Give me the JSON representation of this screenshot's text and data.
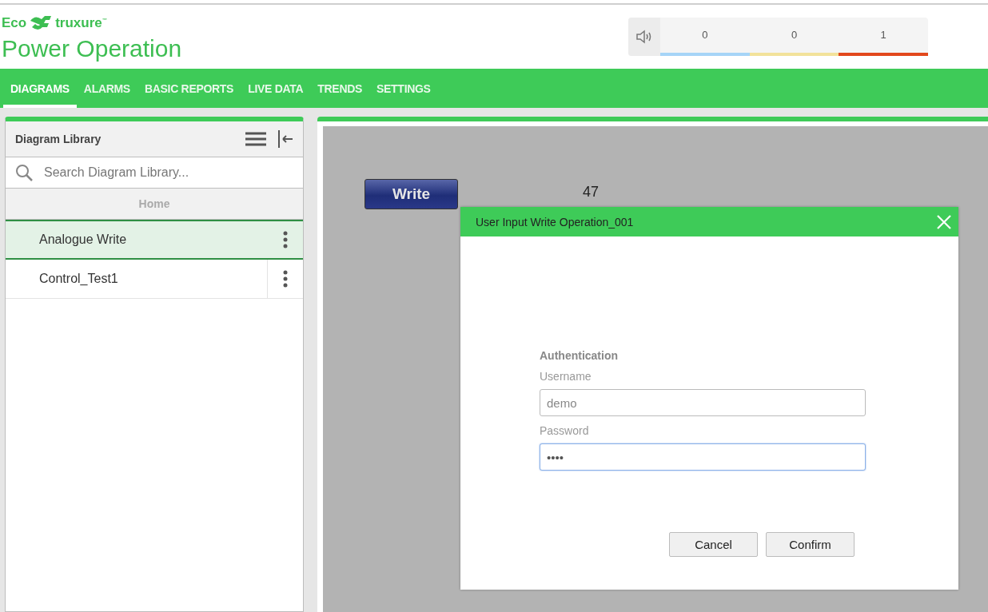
{
  "header": {
    "brand_left": "Eco",
    "brand_right": "truxure",
    "brand_mark": "™",
    "app_title": "Power Operation",
    "alarm_counts": [
      {
        "count": "0",
        "color": "#a6d4f7"
      },
      {
        "count": "0",
        "color": "#f2e29a"
      },
      {
        "count": "1",
        "color": "#e2481c"
      }
    ]
  },
  "nav_tabs": [
    {
      "label": "DIAGRAMS",
      "selected": true
    },
    {
      "label": "ALARMS",
      "selected": false
    },
    {
      "label": "BASIC REPORTS",
      "selected": false
    },
    {
      "label": "LIVE DATA",
      "selected": false
    },
    {
      "label": "TRENDS",
      "selected": false
    },
    {
      "label": "SETTINGS",
      "selected": false
    }
  ],
  "sidebar": {
    "title": "Diagram Library",
    "search": {
      "placeholder": "Search Diagram Library..."
    },
    "breadcrumb": "Home",
    "items": [
      {
        "label": "Analogue Write",
        "selected": true
      },
      {
        "label": "Control_Test1",
        "selected": false
      }
    ]
  },
  "canvas": {
    "write_button": "Write",
    "value": "47"
  },
  "dialog": {
    "title": "User Input Write Operation_001",
    "section": "Authentication",
    "username_label": "Username",
    "username_value": "demo",
    "password_label": "Password",
    "password_value": "••••",
    "buttons": [
      "Cancel",
      "Confirm"
    ]
  }
}
